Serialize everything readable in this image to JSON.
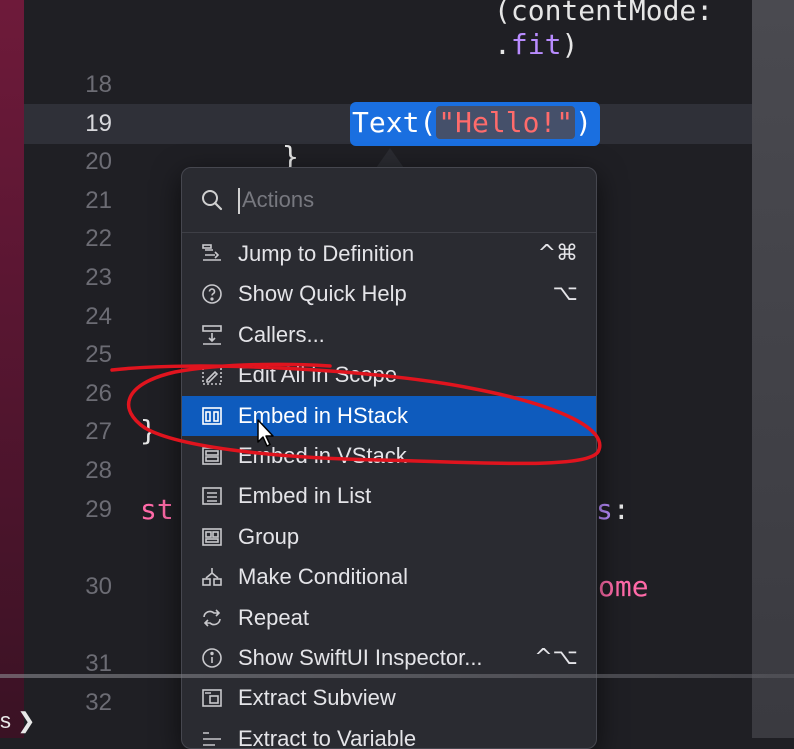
{
  "editor": {
    "line_numbers": [
      "18",
      "19",
      "20",
      "21",
      "22",
      "23",
      "24",
      "25",
      "26",
      "27",
      "28",
      "29",
      "30",
      "31",
      "32"
    ],
    "top_code": {
      "line1": "(contentMode:",
      "line2_dot": ".",
      "line2_fit": "fit",
      "line2_paren": ")"
    },
    "selected_code": {
      "call": "Text(",
      "string": "\"Hello!\"",
      "close": ")"
    },
    "brace_20": "}",
    "brace_27": "}",
    "line29_left": "st",
    "line29_right": "s:",
    "line30_right": "ome"
  },
  "popup": {
    "search_placeholder": "Actions",
    "items": [
      {
        "label": "Jump to Definition",
        "shortcut": "^⌘"
      },
      {
        "label": "Show Quick Help",
        "shortcut": "⌥"
      },
      {
        "label": "Callers...",
        "shortcut": ""
      },
      {
        "label": "Edit All in Scope",
        "shortcut": ""
      },
      {
        "label": "Embed in HStack",
        "shortcut": ""
      },
      {
        "label": "Embed in VStack",
        "shortcut": ""
      },
      {
        "label": "Embed in List",
        "shortcut": ""
      },
      {
        "label": "Group",
        "shortcut": ""
      },
      {
        "label": "Make Conditional",
        "shortcut": ""
      },
      {
        "label": "Repeat",
        "shortcut": ""
      },
      {
        "label": "Show SwiftUI Inspector...",
        "shortcut": "^⌥"
      },
      {
        "label": "Extract Subview",
        "shortcut": ""
      },
      {
        "label": "Extract to Variable",
        "shortcut": ""
      }
    ],
    "selected_index": 4
  },
  "bottom": {
    "text": "s ❯"
  },
  "colors": {
    "accent": "#0e5bbd",
    "selection": "#1a6fe0",
    "string": "#ff6b6b",
    "keyword": "#ff6aa8",
    "annotation": "#e0141e"
  },
  "icons": {
    "search": "search-icon",
    "jump": "jump-to-definition-icon",
    "help": "question-circle-icon",
    "callers": "callers-icon",
    "edit_scope": "edit-scope-icon",
    "hstack": "hstack-icon",
    "vstack": "vstack-icon",
    "list": "list-icon",
    "group": "group-icon",
    "conditional": "conditional-icon",
    "repeat": "repeat-icon",
    "inspector": "info-circle-icon",
    "subview": "extract-subview-icon",
    "variable": "extract-variable-icon"
  }
}
